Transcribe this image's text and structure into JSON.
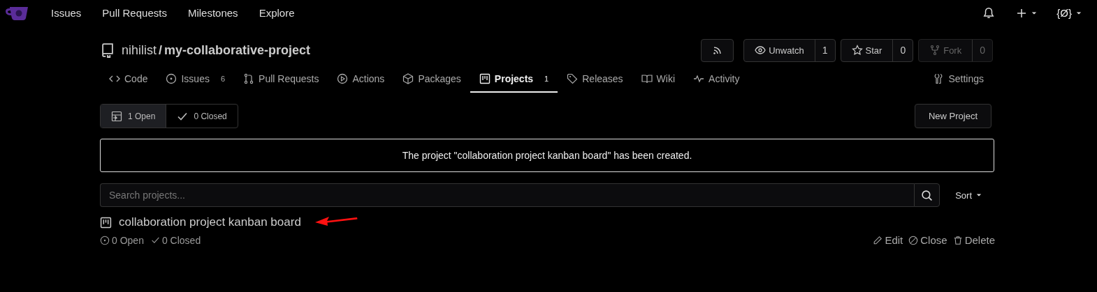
{
  "top_nav": {
    "items": [
      "Issues",
      "Pull Requests",
      "Milestones",
      "Explore"
    ],
    "user_label": "{Ø}"
  },
  "repo": {
    "owner": "nihilist",
    "separator": "/",
    "name": "my-collaborative-project",
    "actions": [
      {
        "label": "Unwatch",
        "count": "1",
        "disabled": false
      },
      {
        "label": "Star",
        "count": "0",
        "disabled": false
      },
      {
        "label": "Fork",
        "count": "0",
        "disabled": true
      }
    ]
  },
  "tabs": [
    {
      "label": "Code",
      "selected": false
    },
    {
      "label": "Issues",
      "count": "6",
      "selected": false
    },
    {
      "label": "Pull Requests",
      "selected": false
    },
    {
      "label": "Actions",
      "selected": false
    },
    {
      "label": "Packages",
      "selected": false
    },
    {
      "label": "Projects",
      "count": "1",
      "selected": true
    },
    {
      "label": "Releases",
      "selected": false
    },
    {
      "label": "Wiki",
      "selected": false
    },
    {
      "label": "Activity",
      "selected": false
    }
  ],
  "settings_tab": {
    "label": "Settings",
    "selected": false
  },
  "filters": [
    {
      "label": "1 Open",
      "selected": true
    },
    {
      "label": "0 Closed",
      "selected": false
    }
  ],
  "new_project_button": "New Project",
  "notice": "The project \"collaboration project kanban board\" has been created.",
  "search": {
    "placeholder": "Search projects..."
  },
  "sort": "Sort",
  "projects": [
    {
      "title": "collaboration project kanban board",
      "open": "0 Open",
      "closed": "0 Closed",
      "actions": [
        "Edit",
        "Close",
        "Delete"
      ]
    }
  ]
}
